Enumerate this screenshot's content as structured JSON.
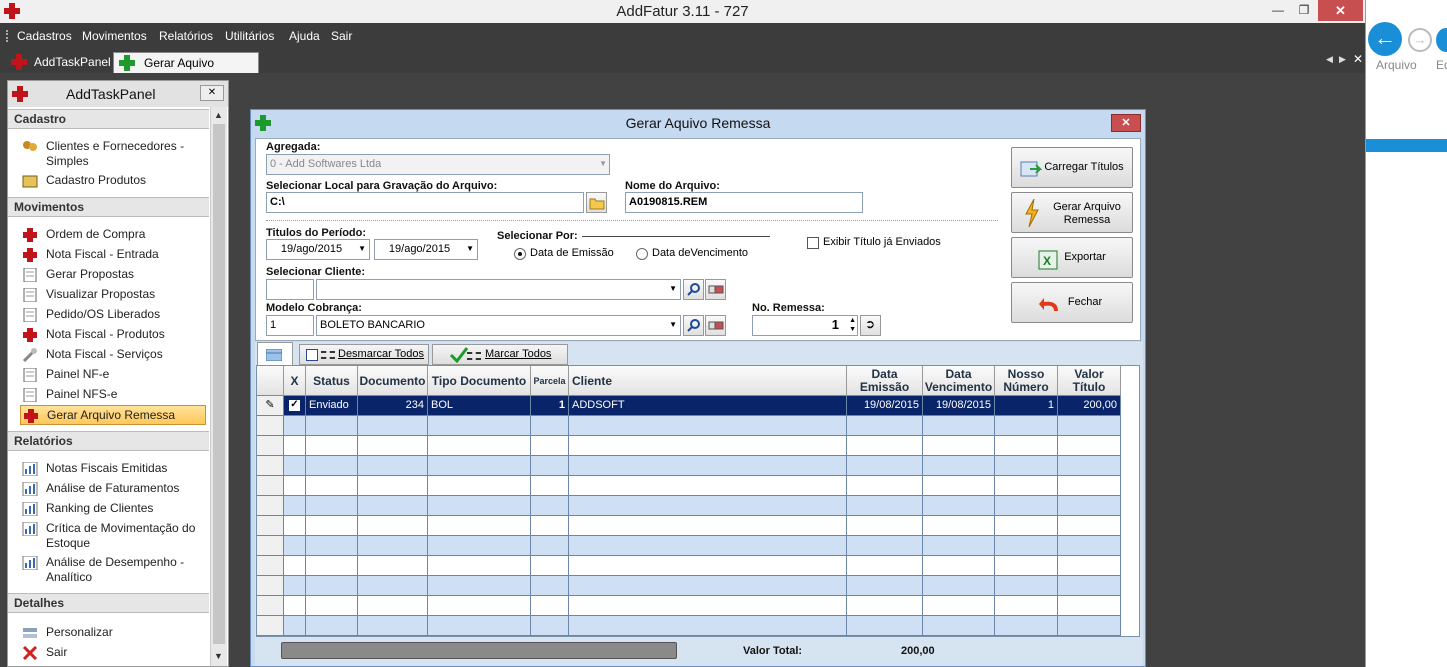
{
  "app": {
    "title": "AddFatur 3.11 - 727"
  },
  "menu": [
    "Cadastros",
    "Movimentos",
    "Relatórios",
    "Utilitários",
    "Ajuda",
    "Sair"
  ],
  "tabs": [
    {
      "label": "AddTaskPanel"
    },
    {
      "label": "Gerar Aquivo Remessa"
    }
  ],
  "right_app": {
    "label_a": "Arquivo",
    "label_b": "Ed"
  },
  "task_panel": {
    "title": "AddTaskPanel",
    "sections": [
      {
        "title": "Cadastro",
        "items": [
          "Clientes e Fornecedores - Simples",
          "Cadastro Produtos"
        ]
      },
      {
        "title": "Movimentos",
        "items": [
          "Ordem de Compra",
          "Nota Fiscal  - Entrada",
          "Gerar Propostas",
          "Visualizar Propostas",
          "Pedido/OS Liberados",
          "Nota Fiscal - Produtos",
          "Nota Fiscal - Serviços",
          "Painel NF-e",
          "Painel NFS-e",
          "Gerar Arquivo Remessa"
        ]
      },
      {
        "title": "Relatórios",
        "items": [
          "Notas Fiscais Emitidas",
          "Análise de Faturamentos",
          "Ranking de Clientes",
          "Crítica de Movimentação do Estoque",
          "Análise de Desempenho - Analítico"
        ]
      },
      {
        "title": "Detalhes",
        "items": [
          "Personalizar",
          "Sair"
        ]
      }
    ]
  },
  "dialog": {
    "title": "Gerar Aquivo Remessa",
    "agregada_label": "Agregada:",
    "agregada_value": "0 - Add Softwares Ltda",
    "local_label": "Selecionar Local para Gravação do Arquivo:",
    "local_value": "C:\\",
    "nome_label": "Nome do Arquivo:",
    "nome_value": "A0190815.REM",
    "periodo_label": "Titulos do Período:",
    "date_from": "19/ago/2015",
    "date_to": "19/ago/2015",
    "selecionar_por_label": "Selecionar Por:",
    "radio_emissao": "Data de Emissão",
    "radio_vencimento": "Data deVencimento",
    "exibir_label": "Exibir Título já Enviados",
    "cliente_label": "Selecionar Cliente:",
    "cliente_code": "",
    "cliente_name": "",
    "modelo_label": "Modelo Cobrança:",
    "modelo_code": "1",
    "modelo_name": "BOLETO BANCARIO",
    "remessa_label": "No. Remessa:",
    "remessa_value": "1",
    "btn_carregar": "Carregar Títulos",
    "btn_gerar": "Gerar Arquivo Remessa",
    "btn_exportar": "Exportar",
    "btn_fechar": "Fechar",
    "btn_desmarcar": "Desmarcar Todos",
    "btn_marcar": "Marcar Todos",
    "total_label": "Valor Total:",
    "total_value": "200,00"
  },
  "grid": {
    "columns": [
      "X",
      "Status",
      "Documento",
      "Tipo Documento",
      "Parcela",
      "Cliente",
      "Data Emissão",
      "Data Vencimento",
      "Nosso Número",
      "Valor Título"
    ],
    "rows": [
      {
        "checked": true,
        "status": "Enviado",
        "documento": "234",
        "tipo": "BOL",
        "parcela": "1",
        "cliente": "ADDSOFT",
        "emissao": "19/08/2015",
        "vencimento": "19/08/2015",
        "nosso": "1",
        "valor": "200,00"
      }
    ]
  },
  "colors": {
    "desk": "#424242",
    "menubar": "#3c3c3c",
    "selected_row": "#0a246a",
    "row_alt": "#cfe0f5",
    "dialog": "#c8daf0",
    "accent_blue": "#1a8fd8"
  }
}
